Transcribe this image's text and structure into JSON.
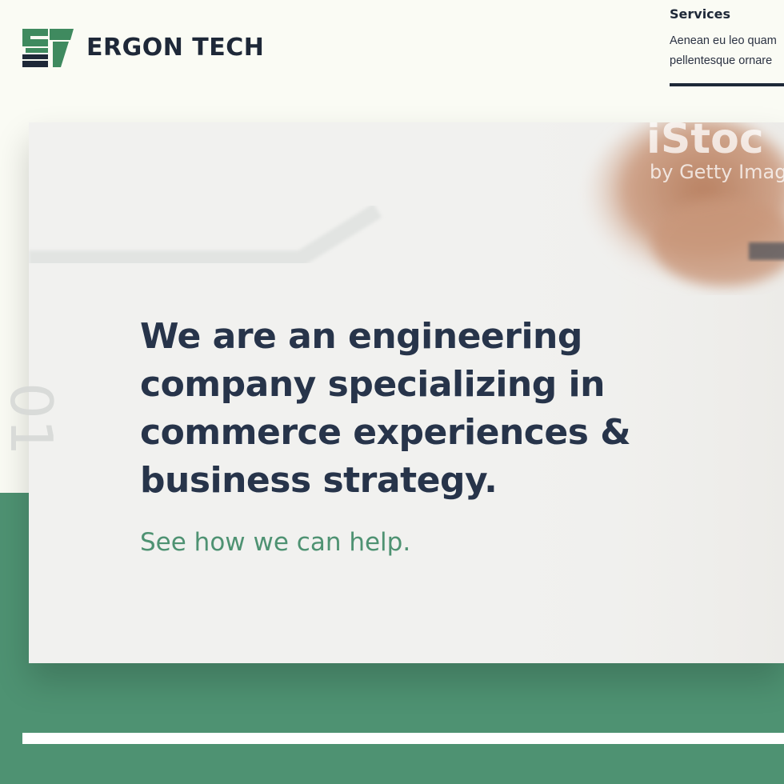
{
  "brand": {
    "name": "ERGON TECH",
    "mark_colors": {
      "green": "#3f8a5f",
      "dark": "#1e2838"
    }
  },
  "nav": {
    "services": {
      "title": "Services",
      "desc_line1": "Aenean eu leo quam",
      "desc_line2": "pellentesque ornare"
    }
  },
  "hero": {
    "headline_lines": [
      "We are an engineering",
      "company specializing in",
      "commerce experiences &",
      "business strategy."
    ],
    "cta": "See how we can help.",
    "watermark_line1": "iStoc",
    "watermark_line2": "by Getty Imag",
    "side_number": "01"
  },
  "colors": {
    "background": "#fafbf4",
    "accent_green": "#4e9272",
    "heading": "#27344a"
  }
}
